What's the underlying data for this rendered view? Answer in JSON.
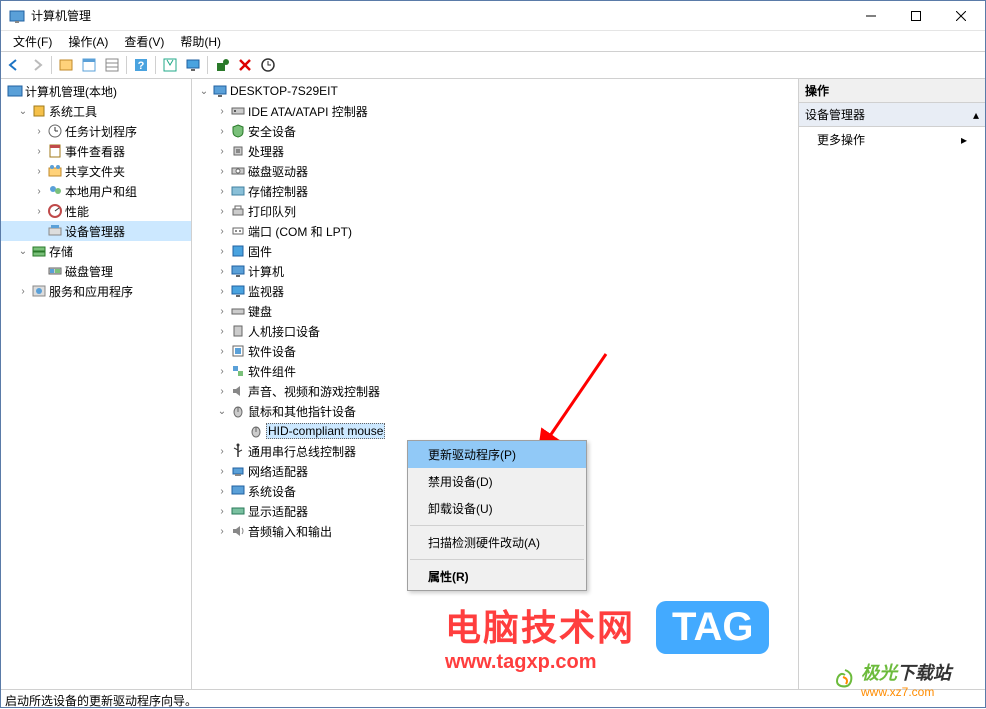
{
  "window": {
    "title": "计算机管理"
  },
  "menubar": {
    "file": "文件(F)",
    "action": "操作(A)",
    "view": "查看(V)",
    "help": "帮助(H)"
  },
  "left_tree": {
    "root": "计算机管理(本地)",
    "sys_tools": "系统工具",
    "task_sched": "任务计划程序",
    "event_viewer": "事件查看器",
    "shared_folders": "共享文件夹",
    "local_users": "本地用户和组",
    "perf": "性能",
    "dev_mgr": "设备管理器",
    "storage": "存储",
    "disk_mgmt": "磁盘管理",
    "services": "服务和应用程序"
  },
  "device_root": "DESKTOP-7S29EIT",
  "devices": {
    "ide": "IDE ATA/ATAPI 控制器",
    "security": "安全设备",
    "cpu": "处理器",
    "disk_drive": "磁盘驱动器",
    "storage_ctrl": "存储控制器",
    "print_queue": "打印队列",
    "ports": "端口 (COM 和 LPT)",
    "firmware": "固件",
    "computer": "计算机",
    "monitor": "监视器",
    "keyboard": "键盘",
    "hid": "人机接口设备",
    "sw_device": "软件设备",
    "sw_component": "软件组件",
    "sound": "声音、视频和游戏控制器",
    "mouse": "鼠标和其他指针设备",
    "hid_mouse": "HID-compliant mouse",
    "usb": "通用串行总线控制器",
    "network": "网络适配器",
    "system": "系统设备",
    "display": "显示适配器",
    "audio_io": "音频输入和输出"
  },
  "context_menu": {
    "update_driver": "更新驱动程序(P)",
    "disable": "禁用设备(D)",
    "uninstall": "卸载设备(U)",
    "scan": "扫描检测硬件改动(A)",
    "properties": "属性(R)"
  },
  "actions_panel": {
    "header": "操作",
    "section": "设备管理器",
    "more": "更多操作"
  },
  "statusbar": "启动所选设备的更新驱动程序向导。",
  "watermark": {
    "cn": "电脑技术网",
    "url": "www.tagxp.com",
    "tag": "TAG",
    "jg1": "极光",
    "jg2": "下载站",
    "jgurl": "www.xz7.com"
  }
}
